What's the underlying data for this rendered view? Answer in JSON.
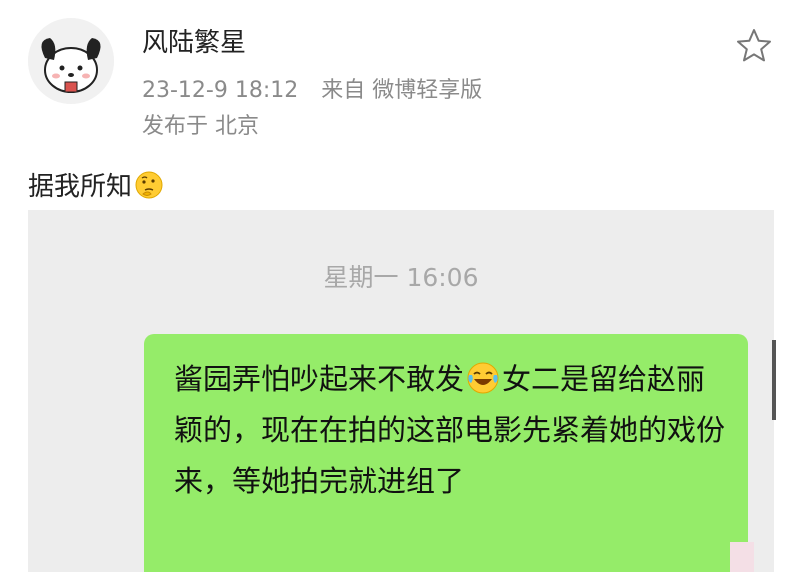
{
  "post": {
    "author": "风陆繁星",
    "timestamp": "23-12-9 18:12",
    "source": "来自 微博轻享版",
    "location": "发布于 北京",
    "text": "据我所知",
    "text_emoji": "thinking-face-icon"
  },
  "chat": {
    "time": "星期一 16:06",
    "message_part1": "酱园弄怕吵起来不敢发",
    "message_emoji": "laughing-tears-icon",
    "message_part2": "女二是留给赵丽颖的，现在在拍的这部电影先紧着她的戏份来，等她拍完就进组了",
    "bubble_color": "#95ec69"
  },
  "icons": {
    "favorite": "star-outline-icon",
    "avatar": "cartoon-dog-avatar"
  }
}
